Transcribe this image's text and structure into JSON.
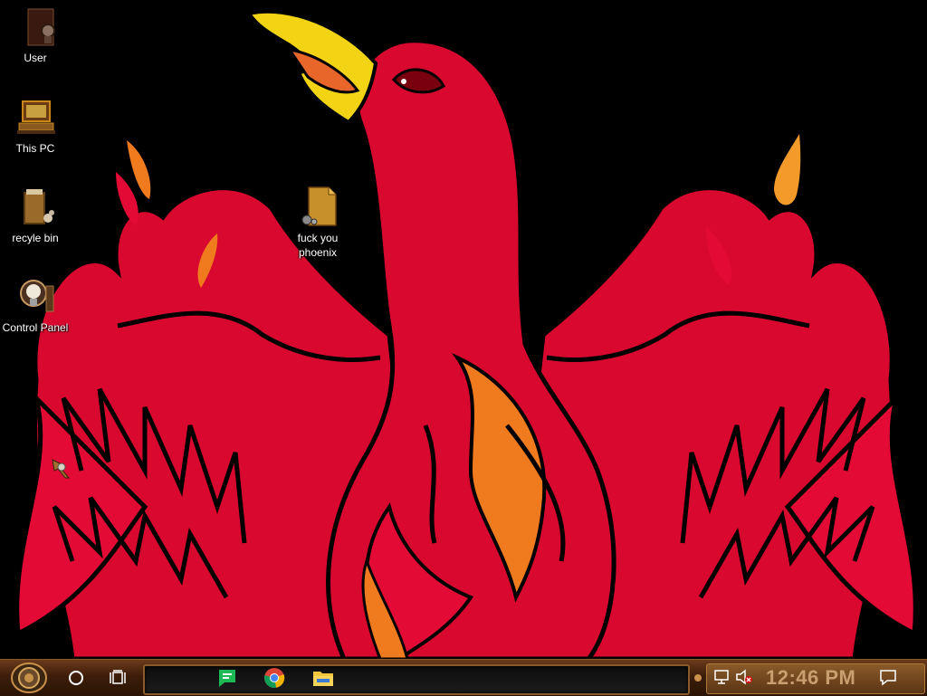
{
  "desktop": {
    "icons": [
      {
        "label": "User",
        "icon": "user-folder-icon"
      },
      {
        "label": "This PC",
        "icon": "computer-icon"
      },
      {
        "label": "recyle bin",
        "icon": "recycle-bin-icon"
      },
      {
        "label": "Control Panel",
        "icon": "control-panel-icon"
      },
      {
        "label": "fuck you phoenix",
        "icon": "document-icon"
      }
    ]
  },
  "wallpaper": {
    "subject": "phoenix-icon",
    "colors": {
      "body": "#d9082e",
      "flame": "#f07a1e",
      "beak": "#f0d818",
      "bg": "#000000"
    }
  },
  "taskbar": {
    "start": "start-gear-icon",
    "search": "cortana-circle-icon",
    "task_view": "task-view-icon",
    "pinned": [
      {
        "name": "messages-app-icon",
        "color": "#1db954"
      },
      {
        "name": "chrome-icon",
        "color": "#4285f4"
      },
      {
        "name": "file-explorer-icon",
        "color": "#f3c63d"
      }
    ],
    "tray": {
      "network": "network-icon",
      "volume": "volume-muted-icon",
      "clock": "12:46 PM",
      "notifications": "action-center-icon"
    }
  }
}
